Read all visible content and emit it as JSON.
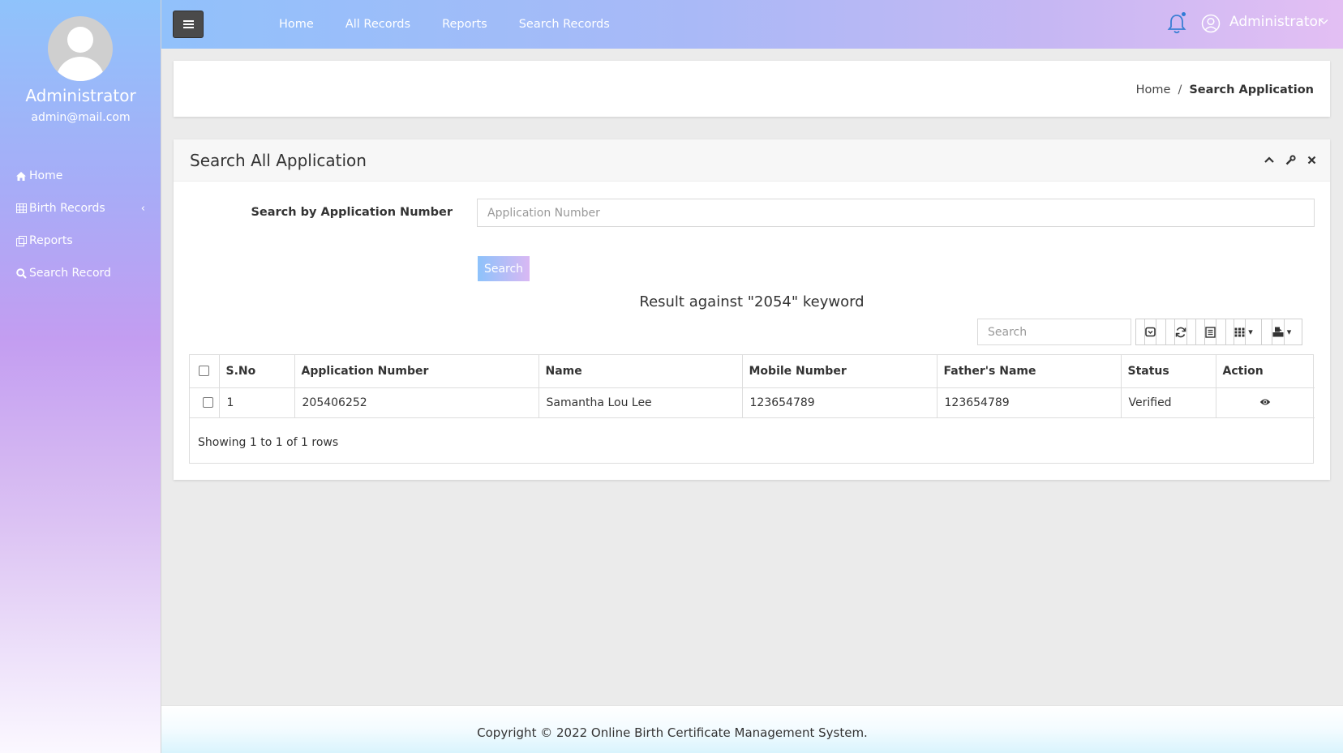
{
  "sidebar": {
    "user_name": "Administrator",
    "user_email": "admin@mail.com",
    "items": [
      {
        "label": "Home",
        "icon": "home-icon"
      },
      {
        "label": "Birth Records",
        "icon": "table-icon"
      },
      {
        "label": "Reports",
        "icon": "copy-icon"
      },
      {
        "label": "Search Record",
        "icon": "search-icon"
      }
    ]
  },
  "topbar": {
    "nav": [
      "Home",
      "All Records",
      "Reports",
      "Search Records"
    ],
    "user_name": "Administrator"
  },
  "breadcrumb": {
    "home": "Home",
    "separator": "/",
    "current": "Search Application"
  },
  "panel": {
    "title": "Search All Application",
    "search_label": "Search by Application Number",
    "input_placeholder": "Application Number",
    "search_button": "Search",
    "result_text": "Result against \"2054\" keyword"
  },
  "table": {
    "search_placeholder": "Search",
    "columns": [
      "S.No",
      "Application Number",
      "Name",
      "Mobile Number",
      "Father's Name",
      "Status",
      "Action"
    ],
    "rows": [
      {
        "sno": "1",
        "app_number": "205406252",
        "name": "Samantha Lou Lee",
        "mobile": "123654789",
        "father": "123654789",
        "status": "Verified"
      }
    ],
    "showing": "Showing 1 to 1 of 1 rows"
  },
  "footer": {
    "text": "Copyright © 2022 Online Birth Certificate Management System."
  },
  "colors": {
    "accent_blue": "#8fc3fb",
    "accent_purple": "#c39df1",
    "toggle_dark": "#4a4a4a"
  }
}
